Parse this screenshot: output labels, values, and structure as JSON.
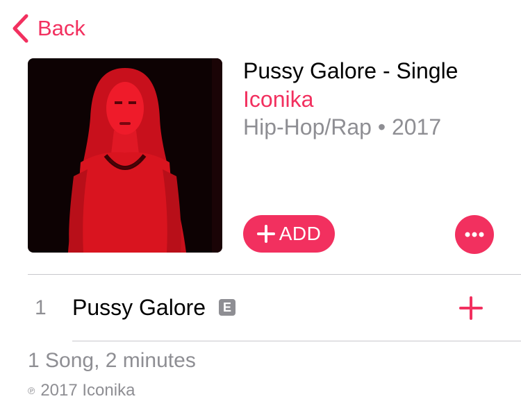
{
  "nav": {
    "back_label": "Back"
  },
  "album": {
    "title": "Pussy Galore - Single",
    "artist": "Iconika",
    "meta": "Hip-Hop/Rap • 2017"
  },
  "actions": {
    "add_label": "ADD"
  },
  "tracks": [
    {
      "number": "1",
      "title": "Pussy Galore",
      "explicit": "E"
    }
  ],
  "footer": {
    "summary": "1 Song, 2 minutes",
    "copyright_symbol": "℗",
    "copyright": "2017 Iconika"
  },
  "colors": {
    "accent": "#f2305f",
    "secondary_text": "#8e8e93",
    "divider": "#c8c7cc"
  },
  "icons": {
    "back": "chevron-left-icon",
    "add": "plus-icon",
    "more": "ellipsis-icon",
    "track_add": "plus-icon",
    "explicit": "explicit-badge"
  }
}
